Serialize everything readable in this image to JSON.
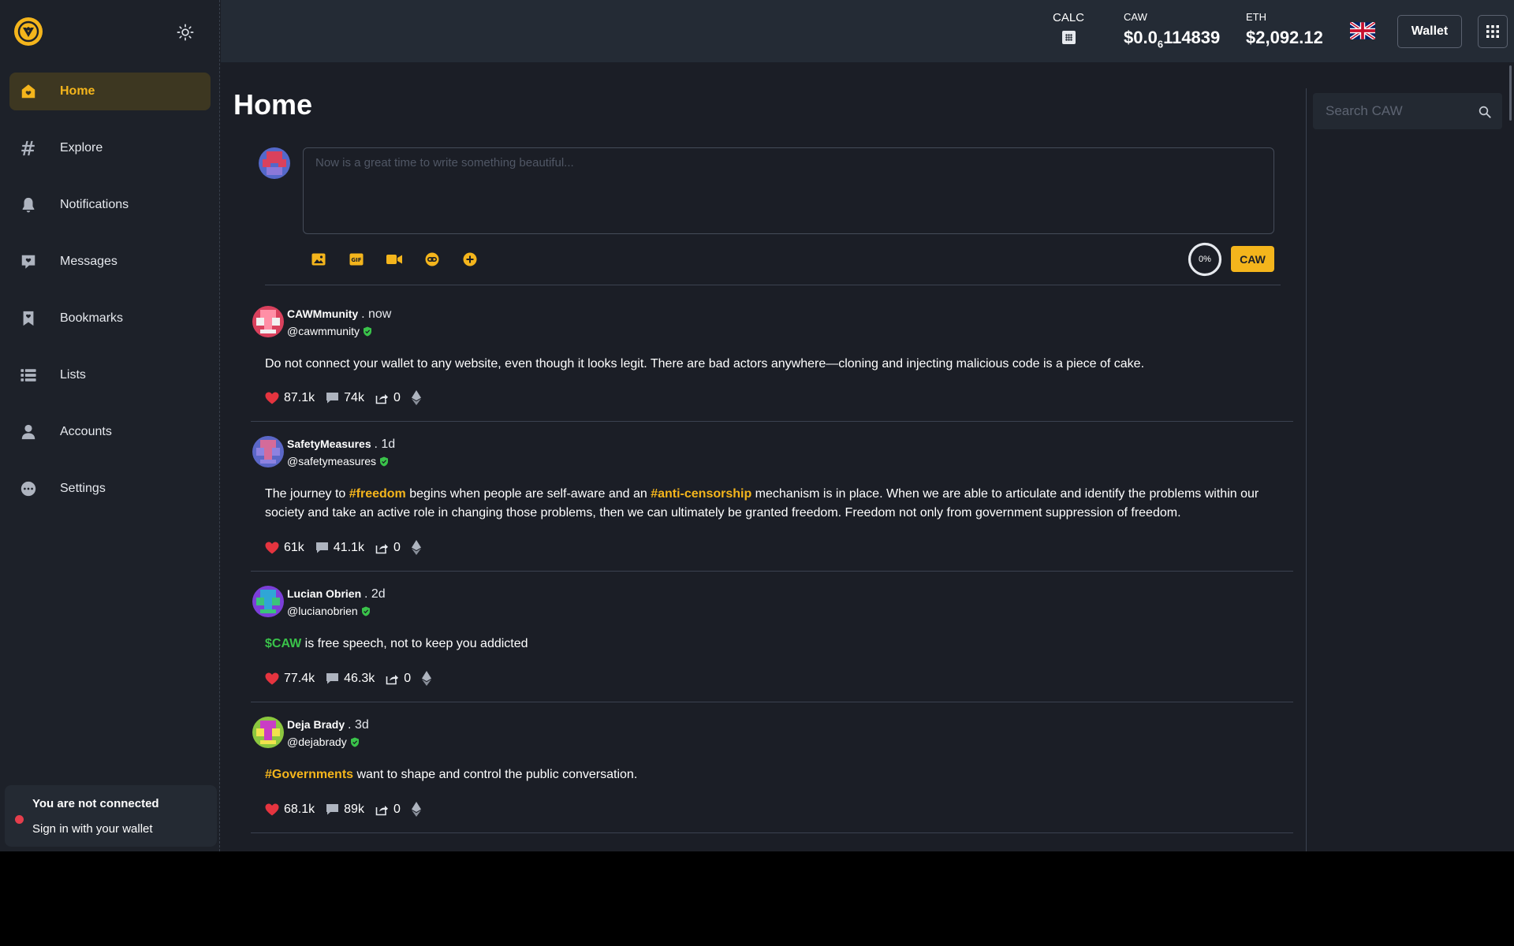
{
  "sidebar": {
    "items": [
      {
        "label": "Home",
        "icon": "home-icon"
      },
      {
        "label": "Explore",
        "icon": "hashtag-icon"
      },
      {
        "label": "Notifications",
        "icon": "bell-icon"
      },
      {
        "label": "Messages",
        "icon": "message-icon"
      },
      {
        "label": "Bookmarks",
        "icon": "bookmark-icon"
      },
      {
        "label": "Lists",
        "icon": "list-icon"
      },
      {
        "label": "Accounts",
        "icon": "person-icon"
      },
      {
        "label": "Settings",
        "icon": "more-icon"
      }
    ],
    "connection": {
      "title": "You are not connected",
      "action": "Sign in with your wallet"
    }
  },
  "topbar": {
    "calc_label": "CALC",
    "caw_label": "CAW",
    "caw_price_prefix": "$0.0",
    "caw_price_zeros": "6",
    "caw_price_digits": "114839",
    "eth_label": "ETH",
    "eth_price": "$2,092.12",
    "wallet_label": "Wallet"
  },
  "main": {
    "title": "Home",
    "composer": {
      "placeholder": "Now is a great time to write something beautiful...",
      "progress": "0%",
      "submit_label": "CAW"
    },
    "search_placeholder": "Search CAW"
  },
  "posts": [
    {
      "name": "CAWMmunity",
      "time": ". now",
      "handle": "@cawmmunity",
      "text": [
        {
          "t": "Do not connect your wallet to any website, even though it looks legit. There are bad actors anywhere—cloning and injecting malicious code is a piece of cake."
        }
      ],
      "likes": "87.1k",
      "comments": "74k",
      "shares": "0"
    },
    {
      "name": "SafetyMeasures",
      "time": ". 1d",
      "handle": "@safetymeasures",
      "text": [
        {
          "t": "The journey to "
        },
        {
          "t": "#freedom",
          "k": "tag"
        },
        {
          "t": " begins when people are self-aware and an "
        },
        {
          "t": "#anti-censorship",
          "k": "tag"
        },
        {
          "t": " mechanism is in place. When we are able to articulate and identify the problems within our society and take an active role in changing those problems, then we can ultimately be granted freedom. Freedom not only from government suppression of freedom."
        }
      ],
      "likes": "61k",
      "comments": "41.1k",
      "shares": "0"
    },
    {
      "name": "Lucian Obrien",
      "time": ". 2d",
      "handle": "@lucianobrien",
      "text": [
        {
          "t": "$CAW",
          "k": "coin"
        },
        {
          "t": " is free speech, not to keep you addicted"
        }
      ],
      "likes": "77.4k",
      "comments": "46.3k",
      "shares": "0"
    },
    {
      "name": "Deja Brady",
      "time": ". 3d",
      "handle": "@dejabrady",
      "text": [
        {
          "t": "#Governments",
          "k": "tag"
        },
        {
          "t": " want to shape and control the public conversation."
        }
      ],
      "likes": "68.1k",
      "comments": "89k",
      "shares": "0"
    }
  ]
}
